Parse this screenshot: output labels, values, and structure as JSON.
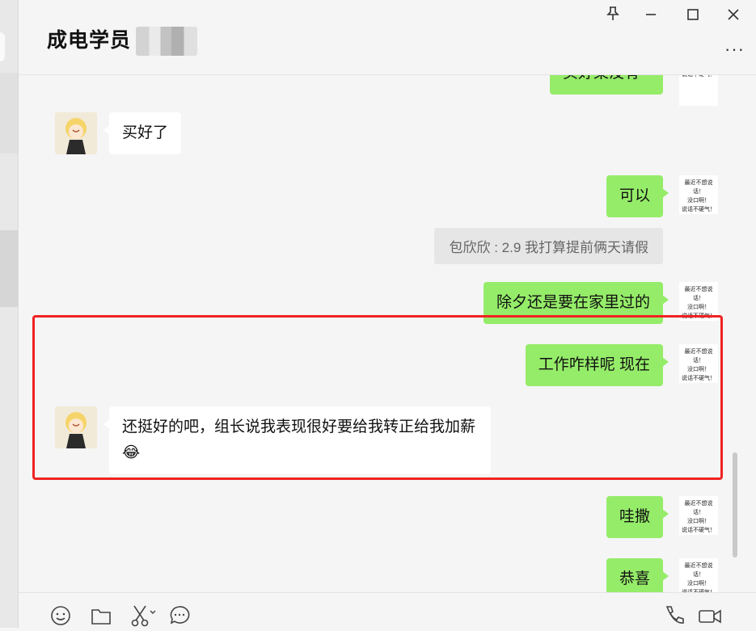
{
  "window": {
    "title": "成电学员",
    "controls": [
      "pin-icon",
      "minimize-icon",
      "maximize-icon",
      "close-icon"
    ],
    "more": "···"
  },
  "avatar_text_right": [
    "最近不想说话！",
    "没口啊！",
    "说话不硬气！"
  ],
  "messages": [
    {
      "side": "right",
      "text": "买好菜没有",
      "partial": true
    },
    {
      "side": "left",
      "text": "买好了"
    },
    {
      "side": "right",
      "text": "可以"
    },
    {
      "side": "quote",
      "text": "包欣欣 : 2.9 我打算提前俩天请假"
    },
    {
      "side": "right",
      "text": "除夕还是要在家里过的"
    },
    {
      "side": "right",
      "text": "工作咋样呢 现在"
    },
    {
      "side": "left",
      "text": "还挺好的吧，组长说我表现很好要给我转正给我加薪😂"
    },
    {
      "side": "right",
      "text": "哇撒"
    },
    {
      "side": "right",
      "text": "恭喜"
    }
  ],
  "toolbar": {
    "left": [
      "emoji-icon",
      "folder-icon",
      "scissors-icon",
      "chat-bubble-icon"
    ],
    "right": [
      "phone-icon",
      "video-icon"
    ]
  },
  "colors": {
    "bubble_self": "#95ec69",
    "bubble_other": "#ffffff",
    "highlight": "#f02222",
    "background": "#f5f5f5"
  }
}
